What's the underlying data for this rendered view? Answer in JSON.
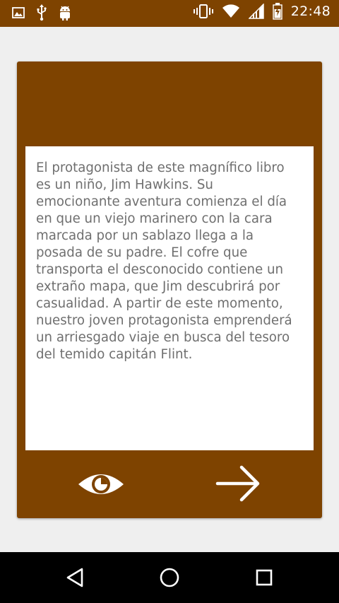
{
  "status_bar": {
    "time": "22:48",
    "left_icons": [
      "image-icon",
      "usb-icon",
      "android-icon"
    ],
    "right_icons": [
      "vibrate-icon",
      "wifi-icon",
      "signal-icon",
      "battery-icon"
    ]
  },
  "card": {
    "description": "El protagonista de este magnífico libro es un niño, Jim Hawkins. Su emocionante aventura comienza el día en que un viejo marinero con la cara marcada por un sablazo llega a la posada de su padre. El cofre que transporta el desconocido contiene un extraño mapa, que Jim descubrirá por casualidad. A partir de este momento, nuestro joven protagonista emprenderá un arriesgado viaje en busca del tesoro del temido capitán Flint.",
    "actions": [
      {
        "name": "view",
        "icon": "eye-icon"
      },
      {
        "name": "next",
        "icon": "arrow-right-icon"
      }
    ]
  },
  "navigation": {
    "buttons": [
      "back-icon",
      "home-icon",
      "recents-icon"
    ]
  },
  "colors": {
    "brand": "#7e4300",
    "background": "#efefef",
    "text": "#6f6f6f",
    "panel": "#ffffff",
    "nav_bar": "#000000"
  }
}
